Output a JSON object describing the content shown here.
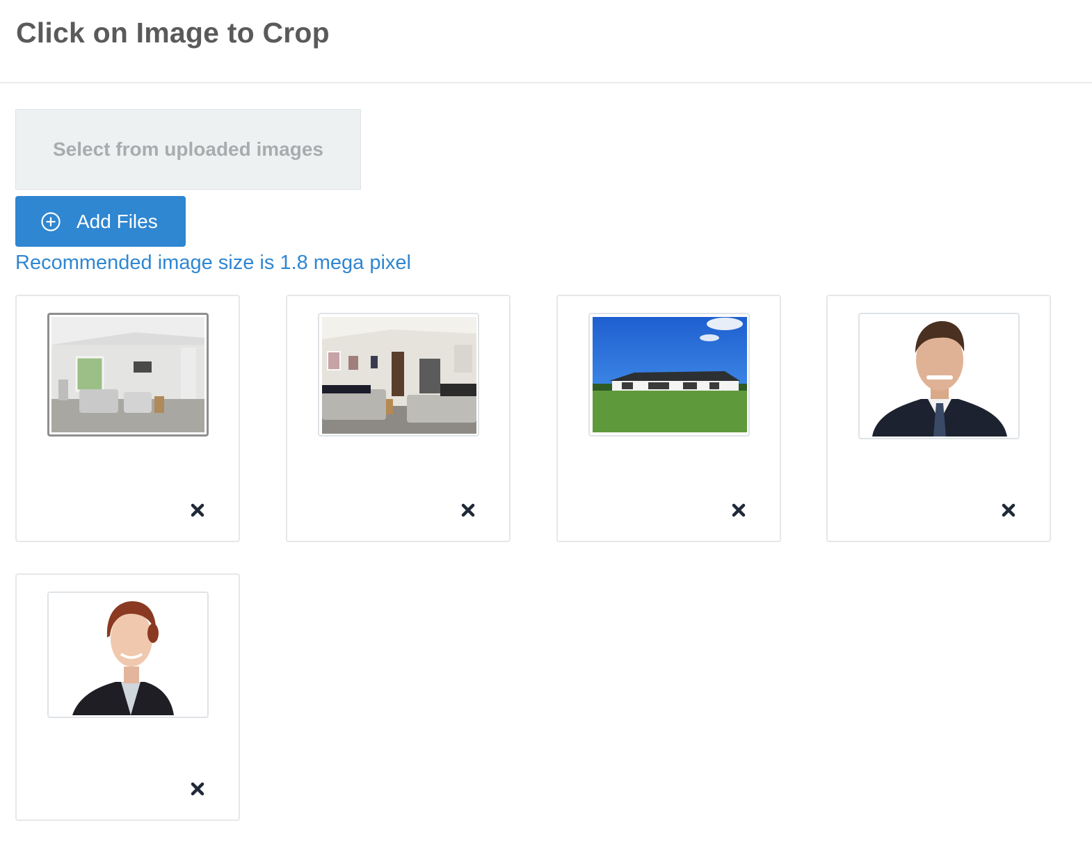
{
  "header": {
    "title": "Click on Image to Crop"
  },
  "actions": {
    "select_uploaded_label": "Select from uploaded images",
    "add_files_label": "Add Files"
  },
  "hint": "Recommended image size is 1.8 mega pixel",
  "colors": {
    "accent": "#2f86d1",
    "title": "#5a5a5a",
    "select_bg": "#eef1f2",
    "select_text": "#a9acae",
    "remove_icon": "#1f2937"
  },
  "icons": {
    "add": "plus-circle-icon",
    "remove": "close-icon"
  },
  "gallery": {
    "items": [
      {
        "name": "living-room-photo",
        "selected": true
      },
      {
        "name": "lounge-photo",
        "selected": false
      },
      {
        "name": "house-exterior-photo",
        "selected": false
      },
      {
        "name": "man-portrait-photo",
        "selected": false
      },
      {
        "name": "woman-portrait-photo",
        "selected": false
      }
    ]
  }
}
